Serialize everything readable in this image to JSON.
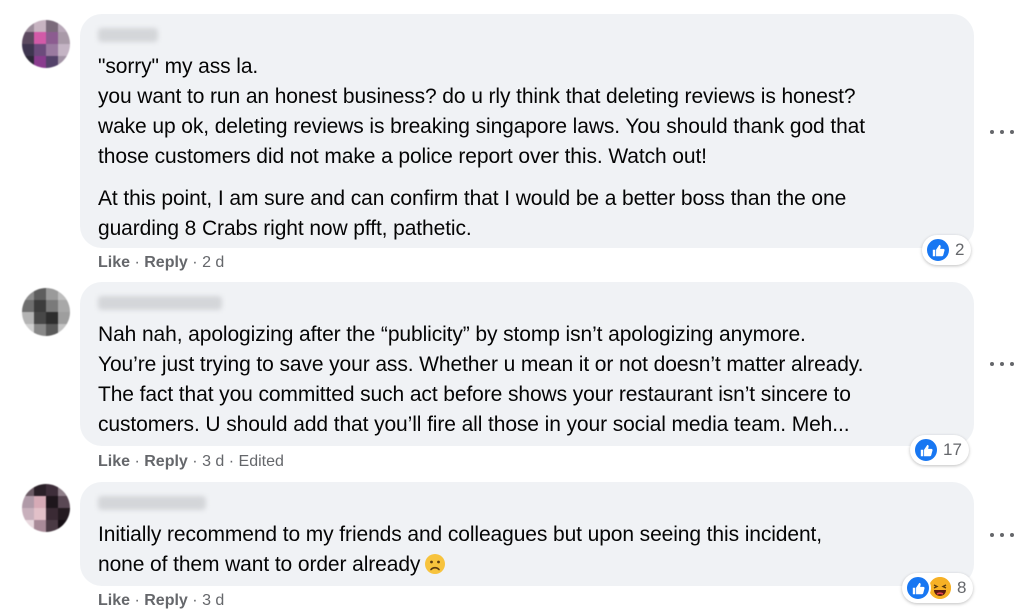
{
  "comments": [
    {
      "lines": [
        "\"sorry\" my ass la.",
        "you want to run an honest business? do u rly think that deleting reviews is honest?",
        "wake up ok, deleting reviews is breaking singapore laws. You should thank god that",
        "those customers did not make a police report over this. Watch out!"
      ],
      "lines2": [
        "At this point, I am sure and can confirm that I would be a better boss than the one",
        "guarding 8 Crabs right now pfft, pathetic."
      ],
      "like_label": "Like",
      "reply_label": "Reply",
      "time": "2 d",
      "reaction_count": "2"
    },
    {
      "lines": [
        "Nah nah, apologizing after the “publicity” by stomp isn’t apologizing anymore.",
        "You’re just trying to save your ass. Whether u mean it or not doesn’t matter already.",
        "The fact that you committed such act before shows your restaurant isn’t sincere to",
        "customers. U should add that you’ll fire all those in your social media team. Meh..."
      ],
      "like_label": "Like",
      "reply_label": "Reply",
      "time": "3 d",
      "edited": "Edited",
      "reaction_count": "17"
    },
    {
      "lines": [
        "Initially recommend to my friends and colleagues but upon seeing this incident,",
        "none of them want to order already"
      ],
      "like_label": "Like",
      "reply_label": "Reply",
      "time": "3 d",
      "reaction_count": "8"
    }
  ],
  "separator": "·",
  "icons": {
    "like": "like-icon",
    "haha": "haha-icon",
    "more": "more-options-icon",
    "emoji": "frowning-face-emoji"
  },
  "colors": {
    "bubble": "#f0f2f5",
    "meta_text": "#65676b",
    "like_blue": "#1877f2",
    "haha_yellow": "#f7b125"
  }
}
